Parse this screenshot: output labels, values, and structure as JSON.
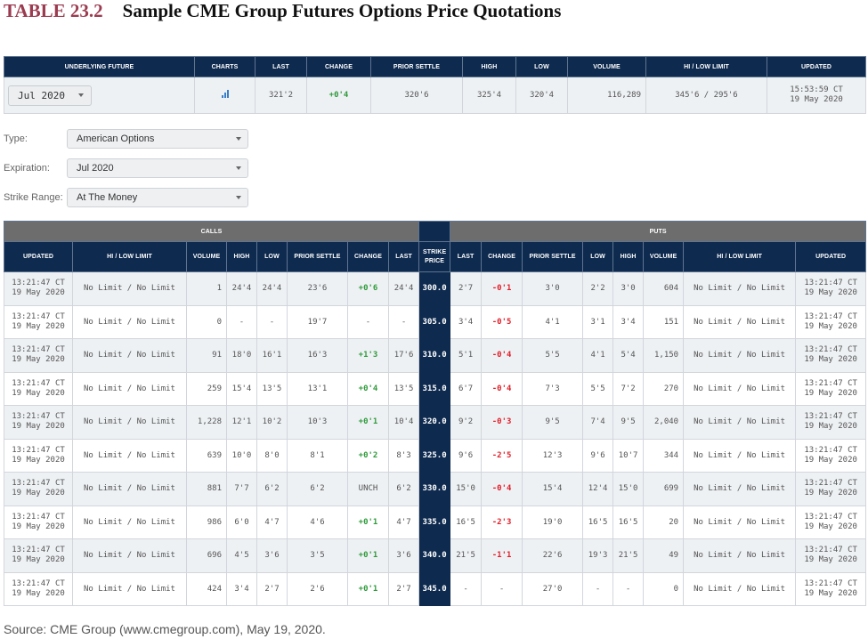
{
  "title": {
    "number": "TABLE 23.2",
    "text": "Sample CME Group Futures Options Price Quotations"
  },
  "colors": {
    "title_accent": "#9b3b50",
    "header_navy": "#0e2a4f",
    "group_grey": "#6d6d6d",
    "positive": "#2e9a3a",
    "negative": "#e0202a",
    "chart_icon": "#3a7dc9"
  },
  "future": {
    "headers": [
      "UNDERLYING FUTURE",
      "CHARTS",
      "LAST",
      "CHANGE",
      "PRIOR SETTLE",
      "HIGH",
      "LOW",
      "VOLUME",
      "HI / LOW LIMIT",
      "UPDATED"
    ],
    "selected_contract": "Jul 2020",
    "chart_icon": "bar-chart-icon",
    "last": "321'2",
    "change": "+0'4",
    "prior_settle": "320'6",
    "high": "325'4",
    "low": "320'4",
    "volume": "116,289",
    "hi_low_limit": "345'6 / 295'6",
    "updated_time": "15:53:59 CT",
    "updated_date": "19 May 2020"
  },
  "filters": [
    {
      "label": "Type:",
      "value": "American Options"
    },
    {
      "label": "Expiration:",
      "value": "Jul 2020"
    },
    {
      "label": "Strike Range:",
      "value": "At The Money"
    }
  ],
  "options": {
    "calls_label": "CALLS",
    "puts_label": "PUTS",
    "call_headers": [
      "UPDATED",
      "HI / LOW LIMIT",
      "VOLUME",
      "HIGH",
      "LOW",
      "PRIOR SETTLE",
      "CHANGE",
      "LAST"
    ],
    "strike_header": "STRIKE PRICE",
    "put_headers": [
      "LAST",
      "CHANGE",
      "PRIOR SETTLE",
      "LOW",
      "HIGH",
      "VOLUME",
      "HI / LOW LIMIT",
      "UPDATED"
    ],
    "rows": [
      {
        "strike": "300.0",
        "call": {
          "time": "13:21:47 CT",
          "date": "19 May 2020",
          "limit": "No Limit / No Limit",
          "volume": "1",
          "high": "24'4",
          "low": "24'4",
          "prior": "23'6",
          "change": "+0'6",
          "last": "24'4"
        },
        "put": {
          "last": "2'7",
          "change": "-0'1",
          "prior": "3'0",
          "low": "2'2",
          "high": "3'0",
          "volume": "604",
          "limit": "No Limit / No Limit",
          "time": "13:21:47 CT",
          "date": "19 May 2020"
        }
      },
      {
        "strike": "305.0",
        "call": {
          "time": "13:21:47 CT",
          "date": "19 May 2020",
          "limit": "No Limit / No Limit",
          "volume": "0",
          "high": "-",
          "low": "-",
          "prior": "19'7",
          "change": "-",
          "last": "-"
        },
        "put": {
          "last": "3'4",
          "change": "-0'5",
          "prior": "4'1",
          "low": "3'1",
          "high": "3'4",
          "volume": "151",
          "limit": "No Limit / No Limit",
          "time": "13:21:47 CT",
          "date": "19 May 2020"
        }
      },
      {
        "strike": "310.0",
        "call": {
          "time": "13:21:47 CT",
          "date": "19 May 2020",
          "limit": "No Limit / No Limit",
          "volume": "91",
          "high": "18'0",
          "low": "16'1",
          "prior": "16'3",
          "change": "+1'3",
          "last": "17'6"
        },
        "put": {
          "last": "5'1",
          "change": "-0'4",
          "prior": "5'5",
          "low": "4'1",
          "high": "5'4",
          "volume": "1,150",
          "limit": "No Limit / No Limit",
          "time": "13:21:47 CT",
          "date": "19 May 2020"
        }
      },
      {
        "strike": "315.0",
        "call": {
          "time": "13:21:47 CT",
          "date": "19 May 2020",
          "limit": "No Limit / No Limit",
          "volume": "259",
          "high": "15'4",
          "low": "13'5",
          "prior": "13'1",
          "change": "+0'4",
          "last": "13'5"
        },
        "put": {
          "last": "6'7",
          "change": "-0'4",
          "prior": "7'3",
          "low": "5'5",
          "high": "7'2",
          "volume": "270",
          "limit": "No Limit / No Limit",
          "time": "13:21:47 CT",
          "date": "19 May 2020"
        }
      },
      {
        "strike": "320.0",
        "call": {
          "time": "13:21:47 CT",
          "date": "19 May 2020",
          "limit": "No Limit / No Limit",
          "volume": "1,228",
          "high": "12'1",
          "low": "10'2",
          "prior": "10'3",
          "change": "+0'1",
          "last": "10'4"
        },
        "put": {
          "last": "9'2",
          "change": "-0'3",
          "prior": "9'5",
          "low": "7'4",
          "high": "9'5",
          "volume": "2,040",
          "limit": "No Limit / No Limit",
          "time": "13:21:47 CT",
          "date": "19 May 2020"
        }
      },
      {
        "strike": "325.0",
        "call": {
          "time": "13:21:47 CT",
          "date": "19 May 2020",
          "limit": "No Limit / No Limit",
          "volume": "639",
          "high": "10'0",
          "low": "8'0",
          "prior": "8'1",
          "change": "+0'2",
          "last": "8'3"
        },
        "put": {
          "last": "9'6",
          "change": "-2'5",
          "prior": "12'3",
          "low": "9'6",
          "high": "10'7",
          "volume": "344",
          "limit": "No Limit / No Limit",
          "time": "13:21:47 CT",
          "date": "19 May 2020"
        }
      },
      {
        "strike": "330.0",
        "call": {
          "time": "13:21:47 CT",
          "date": "19 May 2020",
          "limit": "No Limit / No Limit",
          "volume": "881",
          "high": "7'7",
          "low": "6'2",
          "prior": "6'2",
          "change": "UNCH",
          "last": "6'2"
        },
        "put": {
          "last": "15'0",
          "change": "-0'4",
          "prior": "15'4",
          "low": "12'4",
          "high": "15'0",
          "volume": "699",
          "limit": "No Limit / No Limit",
          "time": "13:21:47 CT",
          "date": "19 May 2020"
        }
      },
      {
        "strike": "335.0",
        "call": {
          "time": "13:21:47 CT",
          "date": "19 May 2020",
          "limit": "No Limit / No Limit",
          "volume": "986",
          "high": "6'0",
          "low": "4'7",
          "prior": "4'6",
          "change": "+0'1",
          "last": "4'7"
        },
        "put": {
          "last": "16'5",
          "change": "-2'3",
          "prior": "19'0",
          "low": "16'5",
          "high": "16'5",
          "volume": "20",
          "limit": "No Limit / No Limit",
          "time": "13:21:47 CT",
          "date": "19 May 2020"
        }
      },
      {
        "strike": "340.0",
        "call": {
          "time": "13:21:47 CT",
          "date": "19 May 2020",
          "limit": "No Limit / No Limit",
          "volume": "696",
          "high": "4'5",
          "low": "3'6",
          "prior": "3'5",
          "change": "+0'1",
          "last": "3'6"
        },
        "put": {
          "last": "21'5",
          "change": "-1'1",
          "prior": "22'6",
          "low": "19'3",
          "high": "21'5",
          "volume": "49",
          "limit": "No Limit / No Limit",
          "time": "13:21:47 CT",
          "date": "19 May 2020"
        }
      },
      {
        "strike": "345.0",
        "call": {
          "time": "13:21:47 CT",
          "date": "19 May 2020",
          "limit": "No Limit / No Limit",
          "volume": "424",
          "high": "3'4",
          "low": "2'7",
          "prior": "2'6",
          "change": "+0'1",
          "last": "2'7"
        },
        "put": {
          "last": "-",
          "change": "-",
          "prior": "27'0",
          "low": "-",
          "high": "-",
          "volume": "0",
          "limit": "No Limit / No Limit",
          "time": "13:21:47 CT",
          "date": "19 May 2020"
        }
      }
    ]
  },
  "source": "Source: CME Group (www.cmegroup.com), May 19, 2020."
}
